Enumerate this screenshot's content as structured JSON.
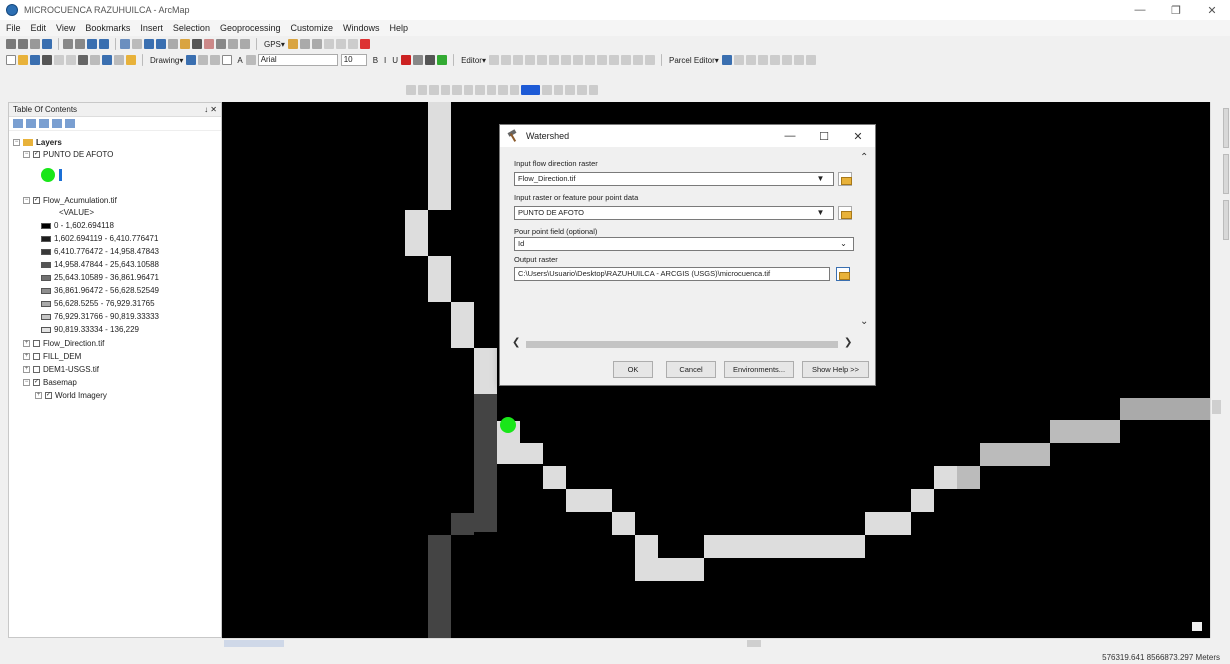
{
  "window": {
    "title": "MICROCUENCA RAZUHUILCA - ArcMap",
    "controls": [
      "—",
      "❐",
      "✕"
    ]
  },
  "menu": [
    "File",
    "Edit",
    "View",
    "Bookmarks",
    "Insert",
    "Selection",
    "Geoprocessing",
    "Customize",
    "Windows",
    "Help"
  ],
  "toolbars": {
    "gps_label": "GPS▾",
    "drawing_label": "Drawing▾",
    "font_name": "Arial",
    "font_size": "10",
    "editor_label": "Editor▾",
    "parcel_editor_label": "Parcel Editor▾"
  },
  "toc": {
    "title": "Table Of Contents",
    "pin": "↓ ✕",
    "layers_label": "Layers",
    "punto_layer": "PUNTO DE AFOTO",
    "flow_acc_layer": "Flow_Acumulation.tif",
    "value_label": "<VALUE>",
    "classes": [
      {
        "label": "0 - 1,602.694118",
        "color": "#000000"
      },
      {
        "label": "1,602.694119 - 6,410.776471",
        "color": "#1c1c1c"
      },
      {
        "label": "6,410.776472 - 14,958.47843",
        "color": "#383838"
      },
      {
        "label": "14,958.47844 - 25,643.10588",
        "color": "#555555"
      },
      {
        "label": "25,643.10589 - 36,861.96471",
        "color": "#717171"
      },
      {
        "label": "36,861.96472 - 56,628.52549",
        "color": "#8e8e8e"
      },
      {
        "label": "56,628.5255 - 76,929.31765",
        "color": "#aaaaaa"
      },
      {
        "label": "76,929.31766 - 90,819.33333",
        "color": "#c6c6c6"
      },
      {
        "label": "90,819.33334 - 136,229",
        "color": "#e3e3e3"
      }
    ],
    "flow_direction_layer": "Flow_Direction.tif",
    "fill_dem_layer": "FILL_DEM",
    "dem_layer": "DEM1-USGS.tif",
    "basemap_layer": "Basemap",
    "world_imagery_layer": "World Imagery"
  },
  "dialog": {
    "title": "Watershed",
    "controls": [
      "—",
      "☐",
      "✕"
    ],
    "flow_dir_label": "Input flow direction raster",
    "flow_dir_value": "Flow_Direction.tif",
    "pour_point_label": "Input raster or feature pour point data",
    "pour_point_value": "PUNTO DE AFOTO",
    "pour_field_label": "Pour point field (optional)",
    "pour_field_value": "Id",
    "output_label": "Output raster",
    "output_value": "C:\\Users\\Usuario\\Desktop\\RAZUHUILCA - ARCGIS (USGS)\\microcuenca.tif",
    "buttons": {
      "ok": "OK",
      "cancel": "Cancel",
      "environments": "Environments...",
      "show_help": "Show Help >>"
    }
  },
  "status": {
    "coordinates": "576319.641  8566873.297 Meters"
  },
  "colors": {
    "pour_point": "#19e619",
    "map_background": "#000000"
  }
}
